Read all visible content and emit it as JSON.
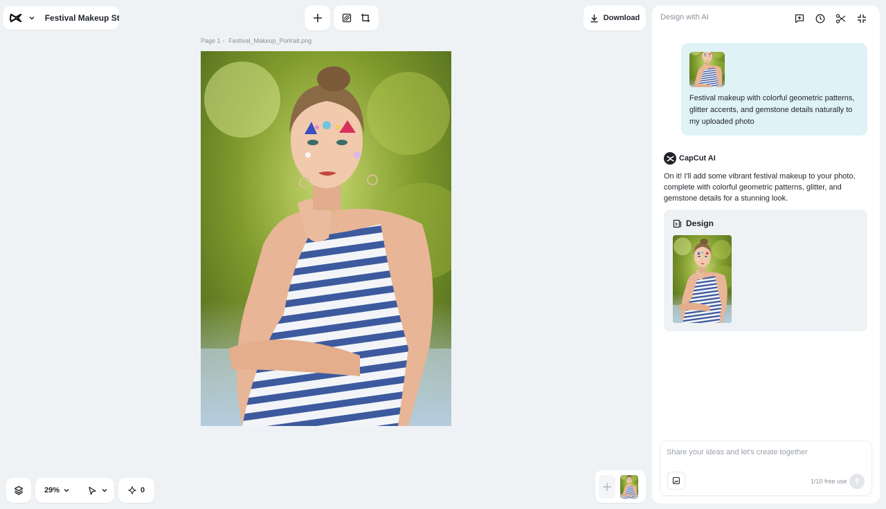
{
  "header": {
    "project_title": "Festival Makeup St...",
    "download_label": "Download"
  },
  "canvas": {
    "page_label": "Page 1 -",
    "file_name": "Festival_Makeup_Portrait.png"
  },
  "bottom_bar": {
    "zoom": "29%",
    "credits": "0"
  },
  "panel": {
    "title": "Design with AI",
    "user_message": "Festival makeup with colorful geometric patterns, glitter accents, and gemstone details naturally to my uploaded photo",
    "ai_name": "CapCut AI",
    "ai_message": "On it! I'll add some vibrant festival makeup to your photo, complete with colorful geometric patterns, glitter, and gemstone details for a stunning look.",
    "design_label": "Design",
    "input_placeholder": "Share your ideas and let's create together",
    "free_use": "1/10 free use"
  },
  "icons": {
    "logo": "capcut-logo-icon",
    "add": "plus-icon",
    "tools": [
      "mask-icon",
      "crop-icon"
    ],
    "download": "download-icon",
    "header_actions": [
      "new-chat-icon",
      "history-icon",
      "share-icon",
      "collapse-icon"
    ],
    "layers": "layers-icon",
    "pointer": "pointer-icon",
    "sparkle": "sparkle-icon",
    "send": "send-icon"
  },
  "colors": {
    "background": "#eff2f5",
    "user_bubble": "#dff2f6",
    "design_card": "#eff2f5",
    "text": "#1f2329",
    "muted": "#8a8f99"
  }
}
